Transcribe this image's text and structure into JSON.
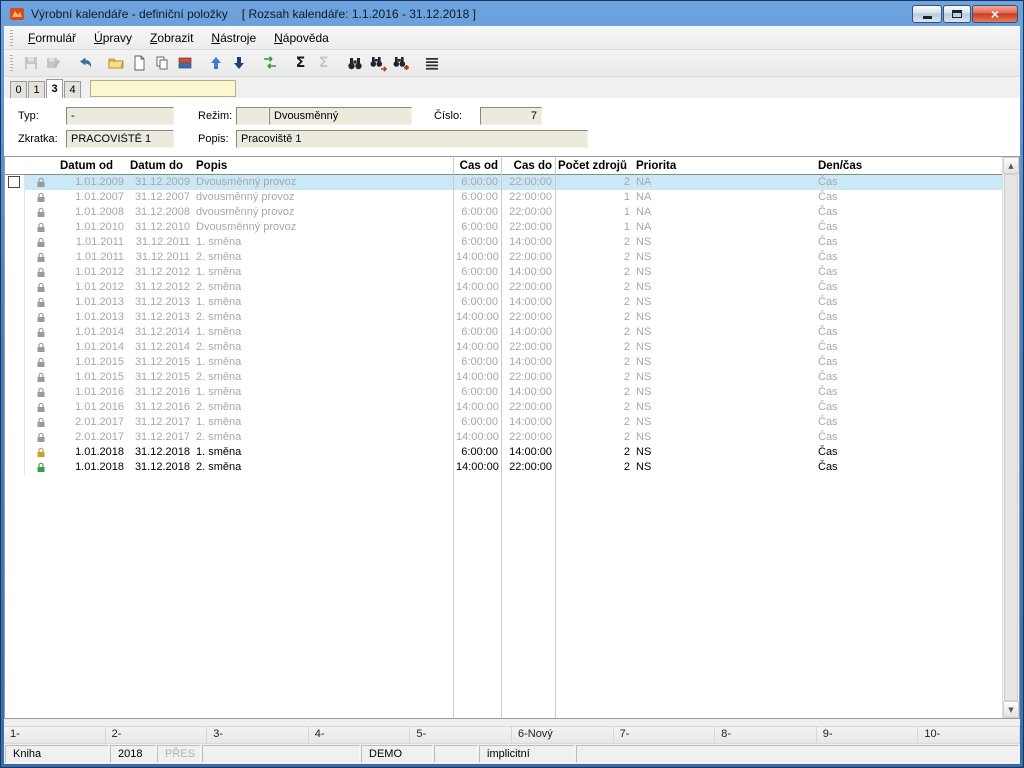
{
  "window": {
    "title": "Výrobní kalendáře - definiční položky",
    "title_suffix": "[ Rozsah kalendáře: 1.1.2016 - 31.12.2018 ]"
  },
  "menu": {
    "items": [
      "Formulář",
      "Úpravy",
      "Zobrazit",
      "Nástroje",
      "Nápověda"
    ]
  },
  "toolbar": {
    "icons": [
      "save-icon",
      "save-record-icon",
      "undo-icon",
      "open-icon",
      "new-record-icon",
      "copy-icon",
      "books-icon",
      "move-up-icon",
      "move-down-icon",
      "reorder-icon",
      "sum-icon",
      "sum-secondary-icon",
      "find-icon",
      "find-next-icon",
      "find-special-icon",
      "list-menu-icon"
    ]
  },
  "tabs": {
    "items": [
      "0",
      "1",
      "3",
      "4"
    ],
    "active": "3",
    "filter_value": ""
  },
  "form": {
    "typ_label": "Typ:",
    "typ_value": "-",
    "rezim_label": "Režim:",
    "rezim_code": "",
    "rezim_value": "Dvousměnný",
    "cislo_label": "Číslo:",
    "cislo_value": "7",
    "zkratka_label": "Zkratka:",
    "zkratka_value": "PRACOVIŠTĚ 1",
    "popis_label": "Popis:",
    "popis_value": "Pracoviště 1"
  },
  "table": {
    "columns": [
      "Datum od",
      "Datum do",
      "Popis",
      "Čas od",
      "Čas do",
      "Počet zdrojů",
      "Priorita",
      "Den/čas"
    ],
    "rows": [
      {
        "datum_od": "1.01.2009",
        "datum_do": "31.12.2009",
        "popis": "Dvousměnný provoz",
        "cas_od": "6:00:00",
        "cas_do": "22:00:00",
        "pocet_zdroju": "2",
        "priorita": "NA",
        "den_cas": "Čas",
        "locked": true,
        "selected": true,
        "lock": "gray"
      },
      {
        "datum_od": "1.01.2007",
        "datum_do": "31.12.2007",
        "popis": "dvousměnný provoz",
        "cas_od": "6:00:00",
        "cas_do": "22:00:00",
        "pocet_zdroju": "1",
        "priorita": "NA",
        "den_cas": "Čas",
        "locked": true,
        "selected": false,
        "lock": "gray"
      },
      {
        "datum_od": "1.01.2008",
        "datum_do": "31.12.2008",
        "popis": "dvousměnný provoz",
        "cas_od": "6:00:00",
        "cas_do": "22:00:00",
        "pocet_zdroju": "1",
        "priorita": "NA",
        "den_cas": "Čas",
        "locked": true,
        "selected": false,
        "lock": "gray"
      },
      {
        "datum_od": "1.01.2010",
        "datum_do": "31.12.2010",
        "popis": "Dvousměnný provoz",
        "cas_od": "6:00:00",
        "cas_do": "22:00:00",
        "pocet_zdroju": "1",
        "priorita": "NA",
        "den_cas": "Čas",
        "locked": true,
        "selected": false,
        "lock": "gray"
      },
      {
        "datum_od": "1.01.2011",
        "datum_do": "31.12.2011",
        "popis": "1. směna",
        "cas_od": "6:00:00",
        "cas_do": "14:00:00",
        "pocet_zdroju": "2",
        "priorita": "NS",
        "den_cas": "Čas",
        "locked": true,
        "selected": false,
        "lock": "gray"
      },
      {
        "datum_od": "1.01.2011",
        "datum_do": "31.12.2011",
        "popis": "2. směna",
        "cas_od": "14:00:00",
        "cas_do": "22:00:00",
        "pocet_zdroju": "2",
        "priorita": "NS",
        "den_cas": "Čas",
        "locked": true,
        "selected": false,
        "lock": "gray"
      },
      {
        "datum_od": "1.01.2012",
        "datum_do": "31.12.2012",
        "popis": "1. směna",
        "cas_od": "6:00:00",
        "cas_do": "14:00:00",
        "pocet_zdroju": "2",
        "priorita": "NS",
        "den_cas": "Čas",
        "locked": true,
        "selected": false,
        "lock": "gray"
      },
      {
        "datum_od": "1.01.2012",
        "datum_do": "31.12.2012",
        "popis": "2. směna",
        "cas_od": "14:00:00",
        "cas_do": "22:00:00",
        "pocet_zdroju": "2",
        "priorita": "NS",
        "den_cas": "Čas",
        "locked": true,
        "selected": false,
        "lock": "gray"
      },
      {
        "datum_od": "1.01.2013",
        "datum_do": "31.12.2013",
        "popis": "1. směna",
        "cas_od": "6:00:00",
        "cas_do": "14:00:00",
        "pocet_zdroju": "2",
        "priorita": "NS",
        "den_cas": "Čas",
        "locked": true,
        "selected": false,
        "lock": "gray"
      },
      {
        "datum_od": "1.01.2013",
        "datum_do": "31.12.2013",
        "popis": "2. směna",
        "cas_od": "14:00:00",
        "cas_do": "22:00:00",
        "pocet_zdroju": "2",
        "priorita": "NS",
        "den_cas": "Čas",
        "locked": true,
        "selected": false,
        "lock": "gray"
      },
      {
        "datum_od": "1.01.2014",
        "datum_do": "31.12.2014",
        "popis": "1. směna",
        "cas_od": "6:00:00",
        "cas_do": "14:00:00",
        "pocet_zdroju": "2",
        "priorita": "NS",
        "den_cas": "Čas",
        "locked": true,
        "selected": false,
        "lock": "gray"
      },
      {
        "datum_od": "1.01.2014",
        "datum_do": "31.12.2014",
        "popis": "2. směna",
        "cas_od": "14:00:00",
        "cas_do": "22:00:00",
        "pocet_zdroju": "2",
        "priorita": "NS",
        "den_cas": "Čas",
        "locked": true,
        "selected": false,
        "lock": "gray"
      },
      {
        "datum_od": "1.01.2015",
        "datum_do": "31.12.2015",
        "popis": "1. směna",
        "cas_od": "6:00:00",
        "cas_do": "14:00:00",
        "pocet_zdroju": "2",
        "priorita": "NS",
        "den_cas": "Čas",
        "locked": true,
        "selected": false,
        "lock": "gray"
      },
      {
        "datum_od": "1.01.2015",
        "datum_do": "31.12.2015",
        "popis": "2. směna",
        "cas_od": "14:00:00",
        "cas_do": "22:00:00",
        "pocet_zdroju": "2",
        "priorita": "NS",
        "den_cas": "Čas",
        "locked": true,
        "selected": false,
        "lock": "gray"
      },
      {
        "datum_od": "1.01.2016",
        "datum_do": "31.12.2016",
        "popis": "1. směna",
        "cas_od": "6:00:00",
        "cas_do": "14:00:00",
        "pocet_zdroju": "2",
        "priorita": "NS",
        "den_cas": "Čas",
        "locked": true,
        "selected": false,
        "lock": "gray"
      },
      {
        "datum_od": "1.01.2016",
        "datum_do": "31.12.2016",
        "popis": "2. směna",
        "cas_od": "14:00:00",
        "cas_do": "22:00:00",
        "pocet_zdroju": "2",
        "priorita": "NS",
        "den_cas": "Čas",
        "locked": true,
        "selected": false,
        "lock": "gray"
      },
      {
        "datum_od": "2.01.2017",
        "datum_do": "31.12.2017",
        "popis": "1. směna",
        "cas_od": "6:00:00",
        "cas_do": "14:00:00",
        "pocet_zdroju": "2",
        "priorita": "NS",
        "den_cas": "Čas",
        "locked": true,
        "selected": false,
        "lock": "gray"
      },
      {
        "datum_od": "2.01.2017",
        "datum_do": "31.12.2017",
        "popis": "2. směna",
        "cas_od": "14:00:00",
        "cas_do": "22:00:00",
        "pocet_zdroju": "2",
        "priorita": "NS",
        "den_cas": "Čas",
        "locked": true,
        "selected": false,
        "lock": "gray"
      },
      {
        "datum_od": "1.01.2018",
        "datum_do": "31.12.2018",
        "popis": "1. směna",
        "cas_od": "6:00:00",
        "cas_do": "14:00:00",
        "pocet_zdroju": "2",
        "priorita": "NS",
        "den_cas": "Čas",
        "locked": false,
        "selected": false,
        "lock": "yellow"
      },
      {
        "datum_od": "1.01.2018",
        "datum_do": "31.12.2018",
        "popis": "2. směna",
        "cas_od": "14:00:00",
        "cas_do": "22:00:00",
        "pocet_zdroju": "2",
        "priorita": "NS",
        "den_cas": "Čas",
        "locked": false,
        "selected": false,
        "lock": "green"
      }
    ]
  },
  "fkeys": {
    "items": [
      "1-",
      "2-",
      "3-",
      "4-",
      "5-",
      "6-Nový",
      "7-",
      "8-",
      "9-",
      "10-"
    ]
  },
  "statusbar": {
    "cells": [
      "Kniha",
      "2018",
      "PŘES",
      "",
      "DEMO",
      "",
      "implicitní",
      ""
    ]
  },
  "colors": {
    "titlebar_blue": "#4a80c4",
    "selected_row": "#cbe8f6",
    "lock_gray": "#9a9a9a",
    "lock_yellow": "#c9a227",
    "lock_green": "#3f9e3f",
    "filter_field_bg": "#fbf7cf"
  }
}
